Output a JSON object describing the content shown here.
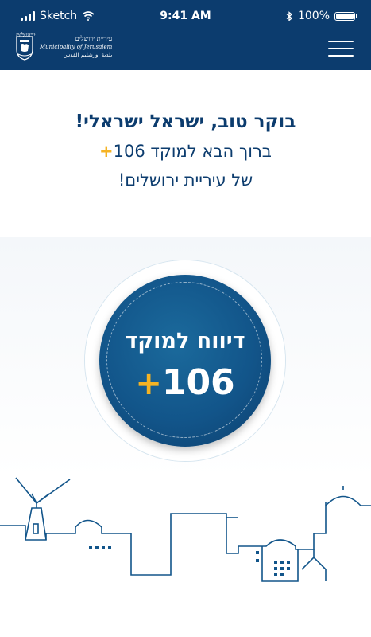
{
  "status_bar": {
    "carrier": "Sketch",
    "time": "9:41 AM",
    "battery": "100%",
    "battery_level": 1.0
  },
  "header": {
    "logo_hebrew_top": "ירושלים",
    "logo_hebrew": "עיריית ירושלים",
    "logo_english": "Municipality of Jerusalem",
    "logo_arabic": "بلدية اورشليم القدس"
  },
  "greeting": {
    "line1": "בוקר טוב, ישראל ישראלי!",
    "line2_prefix": "ברוך הבא למוקד 106",
    "line2_plus": "+",
    "line3": "של עיריית ירושלים!"
  },
  "report_button": {
    "label": "דיווח למוקד",
    "number": "106",
    "plus": "+"
  },
  "colors": {
    "brand": "#0c3c6e",
    "accent": "#f5b323",
    "button": "#12558a"
  },
  "icons": [
    "signal-icon",
    "wifi-icon",
    "bluetooth-icon",
    "battery-icon",
    "menu-icon",
    "jerusalem-emblem-icon",
    "skyline-illustration"
  ]
}
